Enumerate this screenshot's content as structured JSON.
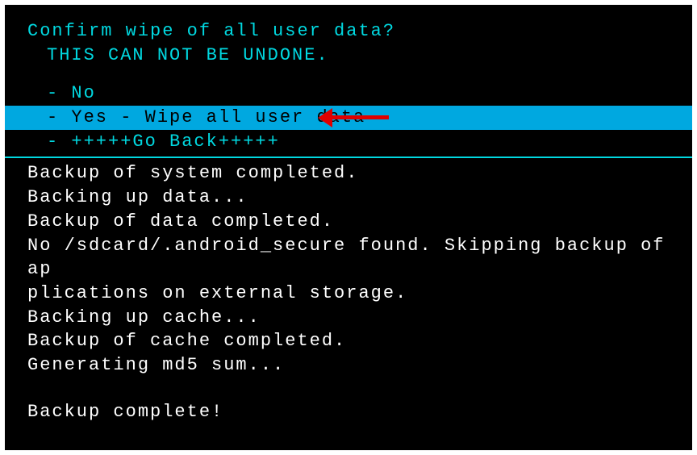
{
  "header": {
    "title": "Confirm wipe of all user data?",
    "warning": "THIS CAN NOT BE UNDONE."
  },
  "menu": {
    "option_no": "- No",
    "option_yes": "- Yes - Wipe all user data",
    "option_back": "- +++++Go Back+++++"
  },
  "log": {
    "line1": "Backup of system completed.",
    "line2": "Backing up data...",
    "line3": "Backup of data completed.",
    "line4": "No /sdcard/.android_secure found. Skipping backup of ap",
    "line5": "plications on external storage.",
    "line6": "Backing up cache...",
    "line7": "Backup of cache completed.",
    "line8": "Generating md5 sum...",
    "line9": "Backup complete!"
  },
  "annotation": {
    "arrow": "red-arrow-pointer"
  }
}
